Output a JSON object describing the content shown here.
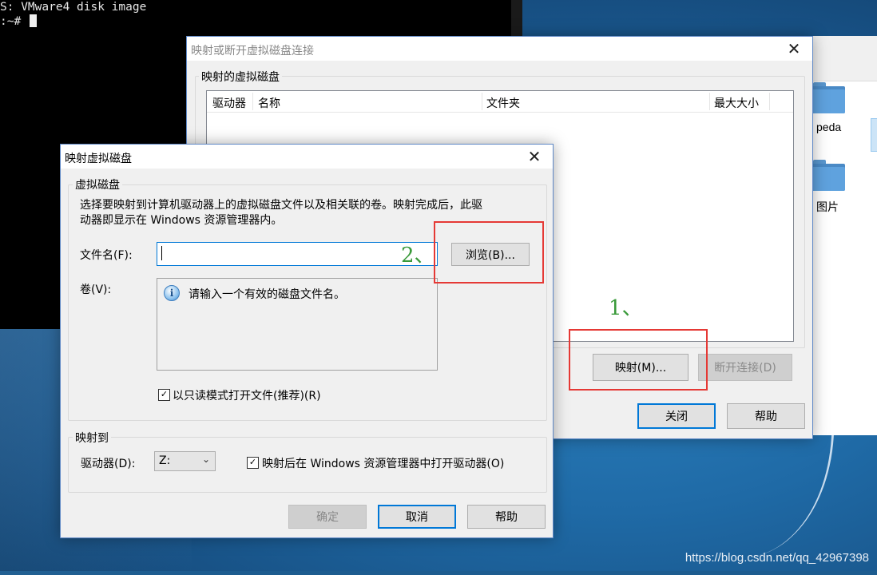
{
  "terminal": {
    "line1": "S: VMware4 disk image",
    "prompt": ":~#"
  },
  "explorer": {
    "folders": [
      "peda",
      "图片"
    ]
  },
  "back_dialog": {
    "title": "映射或断开虚拟磁盘连接",
    "group_label": "映射的虚拟磁盘",
    "columns": [
      "驱动器",
      "名称",
      "文件夹",
      "最大大小"
    ],
    "map_button": "映射(M)...",
    "disconnect_button": "断开连接(D)",
    "close_button": "关闭",
    "help_button": "帮助"
  },
  "front_dialog": {
    "title": "映射虚拟磁盘",
    "group_virtual_disk": "虚拟磁盘",
    "description_line1": "选择要映射到计算机驱动器上的虚拟磁盘文件以及相关联的卷。映射完成后，此驱",
    "description_line2": "动器即显示在 Windows 资源管理器内。",
    "filename_label": "文件名(F):",
    "filename_value": "",
    "browse_button": "浏览(B)...",
    "volume_label": "卷(V):",
    "volume_message": "请输入一个有效的磁盘文件名。",
    "readonly_checkbox_label": "以只读模式打开文件(推荐)(R)",
    "readonly_checked": true,
    "group_map_to": "映射到",
    "drive_label": "驱动器(D):",
    "drive_value": "Z:",
    "open_explorer_label": "映射后在 Windows 资源管理器中打开驱动器(O)",
    "open_explorer_checked": true,
    "ok_button": "确定",
    "cancel_button": "取消",
    "help_button": "帮助"
  },
  "annotations": {
    "step1": "1、",
    "step2": "2、"
  },
  "watermark": "https://blog.csdn.net/qq_42967398",
  "colors": {
    "annotation_red": "#e53935",
    "annotation_green": "#3a9a3a",
    "focus_blue": "#0078d7"
  }
}
